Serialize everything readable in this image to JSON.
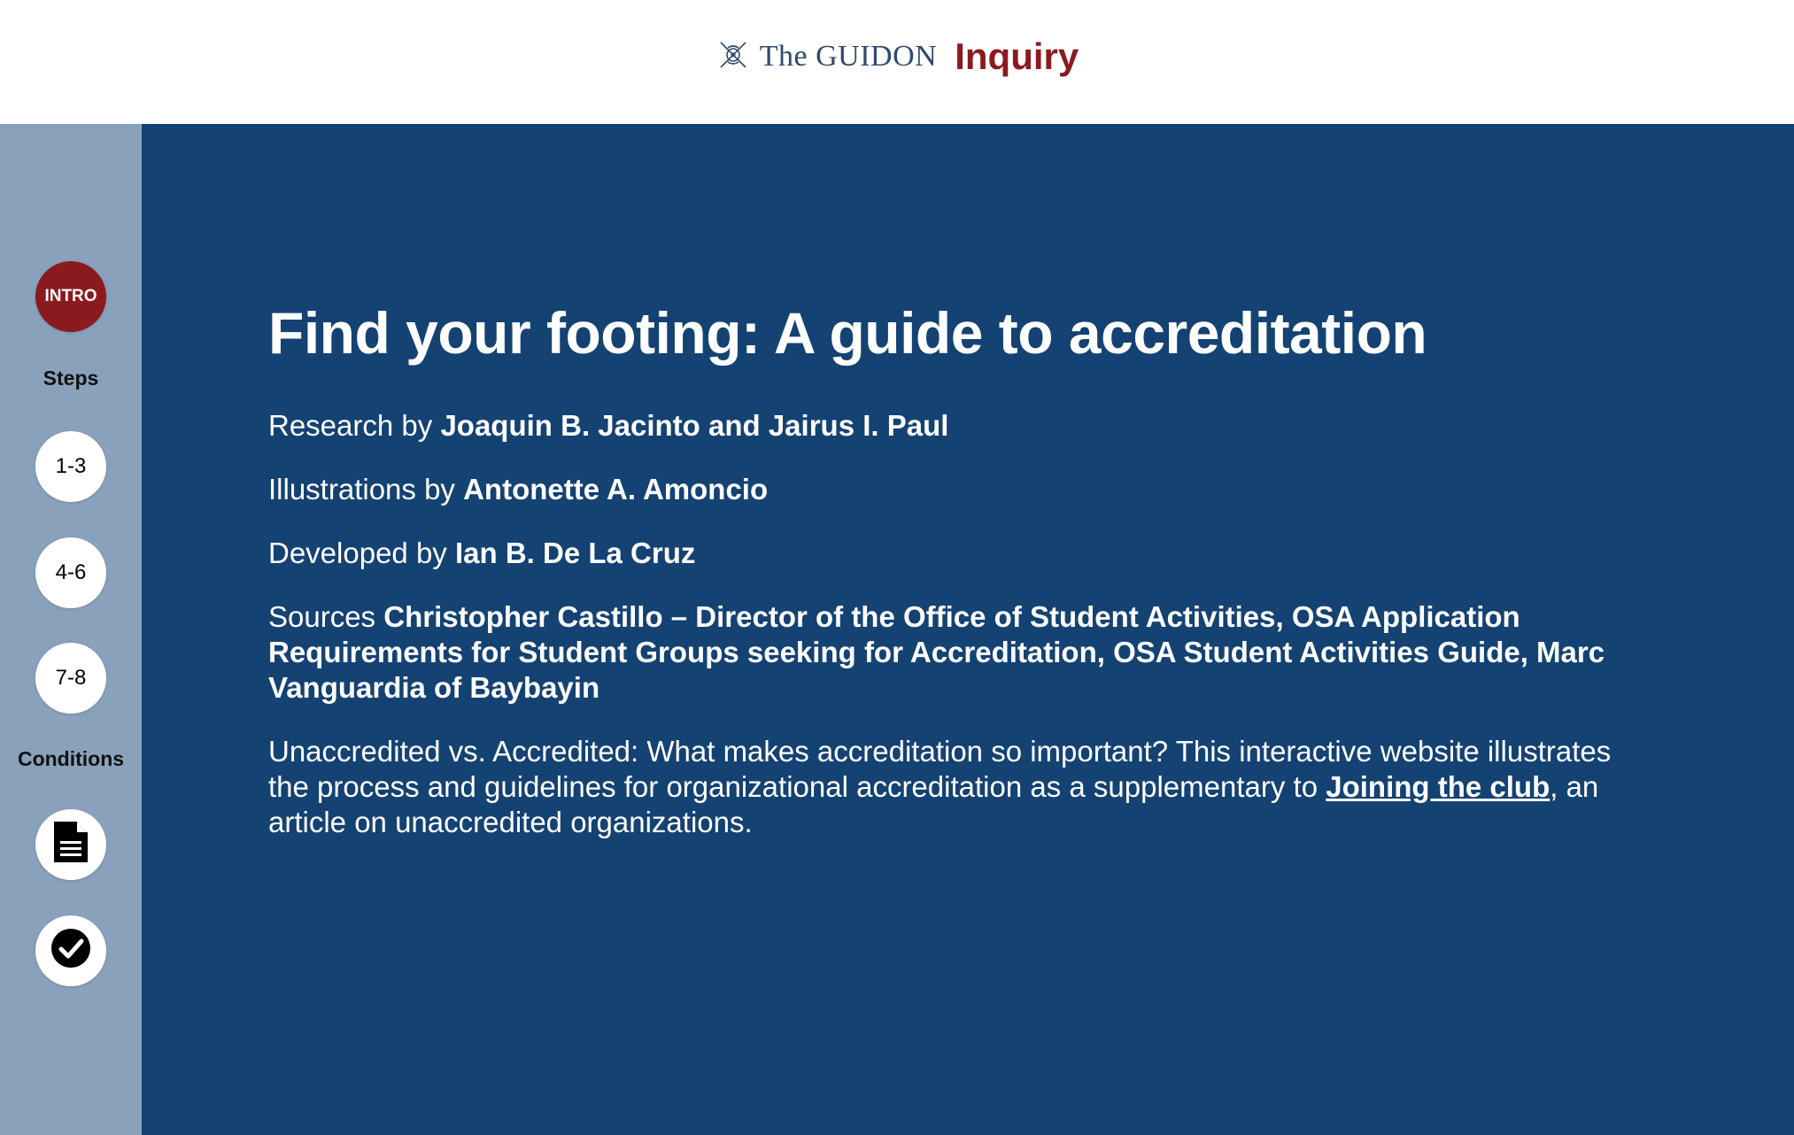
{
  "header": {
    "brand_name": "The GUIDON",
    "section_name": "Inquiry"
  },
  "sidebar": {
    "intro_label": "INTRO",
    "steps_heading": "Steps",
    "steps": [
      {
        "label": "1-3"
      },
      {
        "label": "4-6"
      },
      {
        "label": "7-8"
      }
    ],
    "conditions_heading": "Conditions",
    "condition_icons": [
      "document-icon",
      "checkmark-circle-icon"
    ]
  },
  "main": {
    "title": "Find your footing: A guide to accreditation",
    "credits": [
      {
        "prefix": "Research by ",
        "names": "Joaquin B. Jacinto and Jairus I. Paul"
      },
      {
        "prefix": "Illustrations by ",
        "names": "Antonette A. Amoncio"
      },
      {
        "prefix": "Developed by ",
        "names": "Ian B. De La Cruz"
      },
      {
        "prefix": "Sources ",
        "names": "Christopher Castillo – Director of the Office of Student Activities, OSA Application Requirements for Student Groups seeking for Accreditation, OSA Student Activities Guide, Marc Vanguardia of Baybayin"
      }
    ],
    "intro_text_before": "Unaccredited vs. Accredited: What makes accreditation so important? This interactive website illustrates the process and guidelines for organizational accreditation as a supplementary to ",
    "intro_link": "Joining the club",
    "intro_text_after": ", an article on unaccredited organizations."
  },
  "colors": {
    "main_background": "#144272",
    "sidebar_background": "#8aa1bb",
    "accent_red": "#8b1a1f",
    "brand_blue": "#2f4a6b"
  }
}
